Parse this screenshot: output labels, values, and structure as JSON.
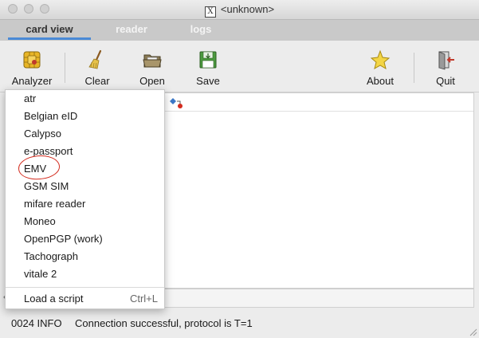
{
  "window": {
    "title": "<unknown>"
  },
  "tabs": [
    {
      "label": "card view",
      "active": true
    },
    {
      "label": "reader",
      "active": false
    },
    {
      "label": "logs",
      "active": false
    }
  ],
  "toolbar": {
    "analyzer": "Analyzer",
    "clear": "Clear",
    "open": "Open",
    "save": "Save",
    "about": "About",
    "quit": "Quit"
  },
  "menu": {
    "items": [
      "atr",
      "Belgian eID",
      "Calypso",
      "e-passport",
      "EMV",
      "GSM SIM",
      "mifare reader",
      "Moneo",
      "OpenPGP (work)",
      "Tachograph",
      "vitale 2"
    ],
    "load_script": "Load a script",
    "load_script_shortcut": "Ctrl+L",
    "highlighted_item": "EMV"
  },
  "status": {
    "code": "0024 INFO",
    "message": "Connection successful, protocol is T=1"
  },
  "colors": {
    "accent": "#4a8ad6",
    "highlight_circle": "#d32b1e"
  }
}
